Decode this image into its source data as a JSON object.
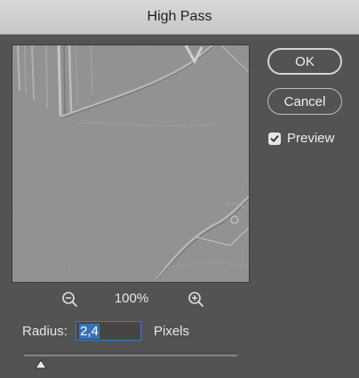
{
  "window": {
    "title": "High Pass"
  },
  "buttons": {
    "ok_label": "OK",
    "cancel_label": "Cancel"
  },
  "preview": {
    "label": "Preview",
    "checked": true
  },
  "zoom": {
    "value": "100%",
    "zoom_out_icon": "zoom-out-icon",
    "zoom_in_icon": "zoom-in-icon"
  },
  "radius": {
    "label": "Radius:",
    "value": "2,4",
    "units": "Pixels",
    "slider_position": 0.08
  },
  "colors": {
    "dialog_bg": "#535353",
    "titlebar_bg": "#d2d2d2",
    "selection": "#3d6fb6",
    "focus_border": "#3d77c4"
  }
}
